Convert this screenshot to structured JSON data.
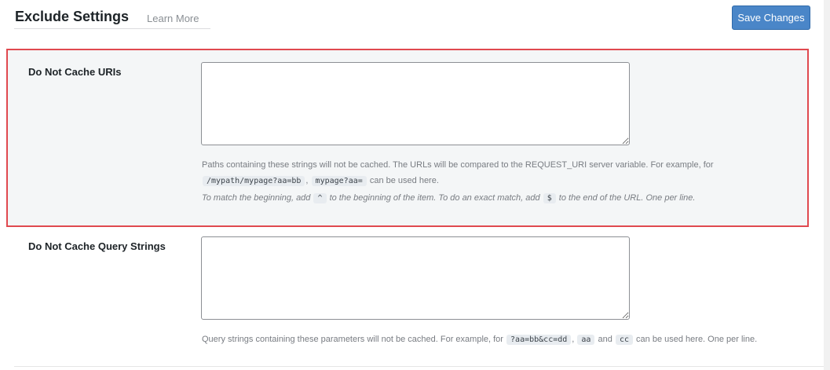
{
  "header": {
    "title": "Exclude Settings",
    "learn_more": "Learn More",
    "save_label": "Save Changes"
  },
  "fields": [
    {
      "label": "Do Not Cache URIs",
      "value": "",
      "desc1": {
        "text": "Paths containing these strings will not be cached. The URLs will be compared to the REQUEST_URI server variable. For example, for"
      },
      "desc2": {
        "code1": "/mypath/mypage?aa=bb",
        "sep": ",",
        "code2": "mypage?aa=",
        "text": "can be used here."
      },
      "desc3": {
        "pre": "To match the beginning, add",
        "code1": "^",
        "mid": "to the beginning of the item. To do an exact match, add",
        "code2": "$",
        "post": "to the end of the URL. One per line."
      }
    },
    {
      "label": "Do Not Cache Query Strings",
      "value": "",
      "desc": {
        "pre": "Query strings containing these parameters will not be cached. For example, for",
        "code1": "?aa=bb&cc=dd",
        "sep": ",",
        "code2": "aa",
        "and": "and",
        "code3": "cc",
        "post": "can be used here. One per line."
      }
    }
  ],
  "colors": {
    "highlight_border": "#e0494f",
    "button_bg": "#4a86c8"
  }
}
